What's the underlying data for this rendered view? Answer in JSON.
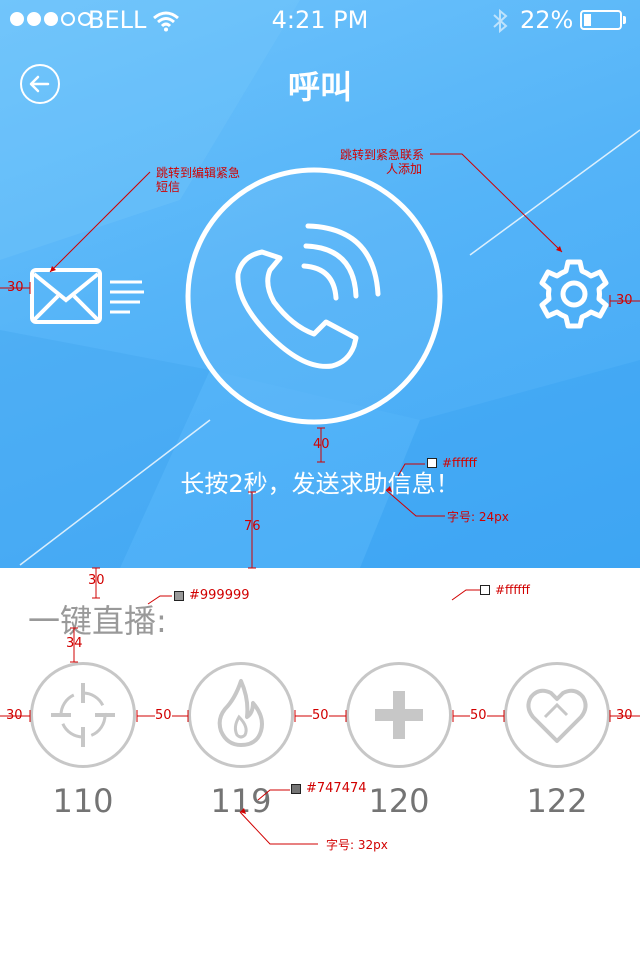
{
  "status_bar": {
    "carrier": "BELL",
    "time": "4:21 PM",
    "battery_percent": "22%",
    "battery_level": 0.22,
    "signal_bars": 3,
    "signal_max": 5
  },
  "nav": {
    "title": "呼叫",
    "back_icon": "arrow-left-circle-icon"
  },
  "hero": {
    "call_icon": "phone-signal-icon",
    "sms_icon": "envelope-lines-icon",
    "settings_icon": "gear-icon",
    "hint": "长按2秒，发送求助信息！"
  },
  "direct_dial": {
    "title": "一键直播:",
    "services": [
      {
        "icon": "crosshair-icon",
        "number": "110"
      },
      {
        "icon": "flame-icon",
        "number": "119"
      },
      {
        "icon": "plus-icon",
        "number": "120"
      },
      {
        "icon": "heart-icon",
        "number": "122"
      }
    ]
  },
  "annotations": {
    "sms_note_line1": "跳转到编辑紧急",
    "sms_note_line2": "短信",
    "settings_note_line1": "跳转到紧急联系",
    "settings_note_line2": "人添加",
    "gap_left_mail": "30",
    "gap_right_gear": "30",
    "gap_circle_text": "40",
    "hint_color": "#ffffff",
    "hint_size": "字号: 24px",
    "gap_text_bottom": "76",
    "gap_top_section": "30",
    "section_color": "#999999",
    "bg_color": "#ffffff",
    "gap_title_icons": "34",
    "margin_left": "30",
    "gap_1": "50",
    "gap_2": "50",
    "gap_3": "50",
    "margin_right": "30",
    "number_color": "#747474",
    "number_size": "字号: 32px"
  },
  "colors": {
    "hero_gradient_start": "#6ec3fb",
    "hero_gradient_end": "#42a8f5",
    "annotation_red": "#d10000",
    "icon_grey": "#c7c7c7"
  }
}
